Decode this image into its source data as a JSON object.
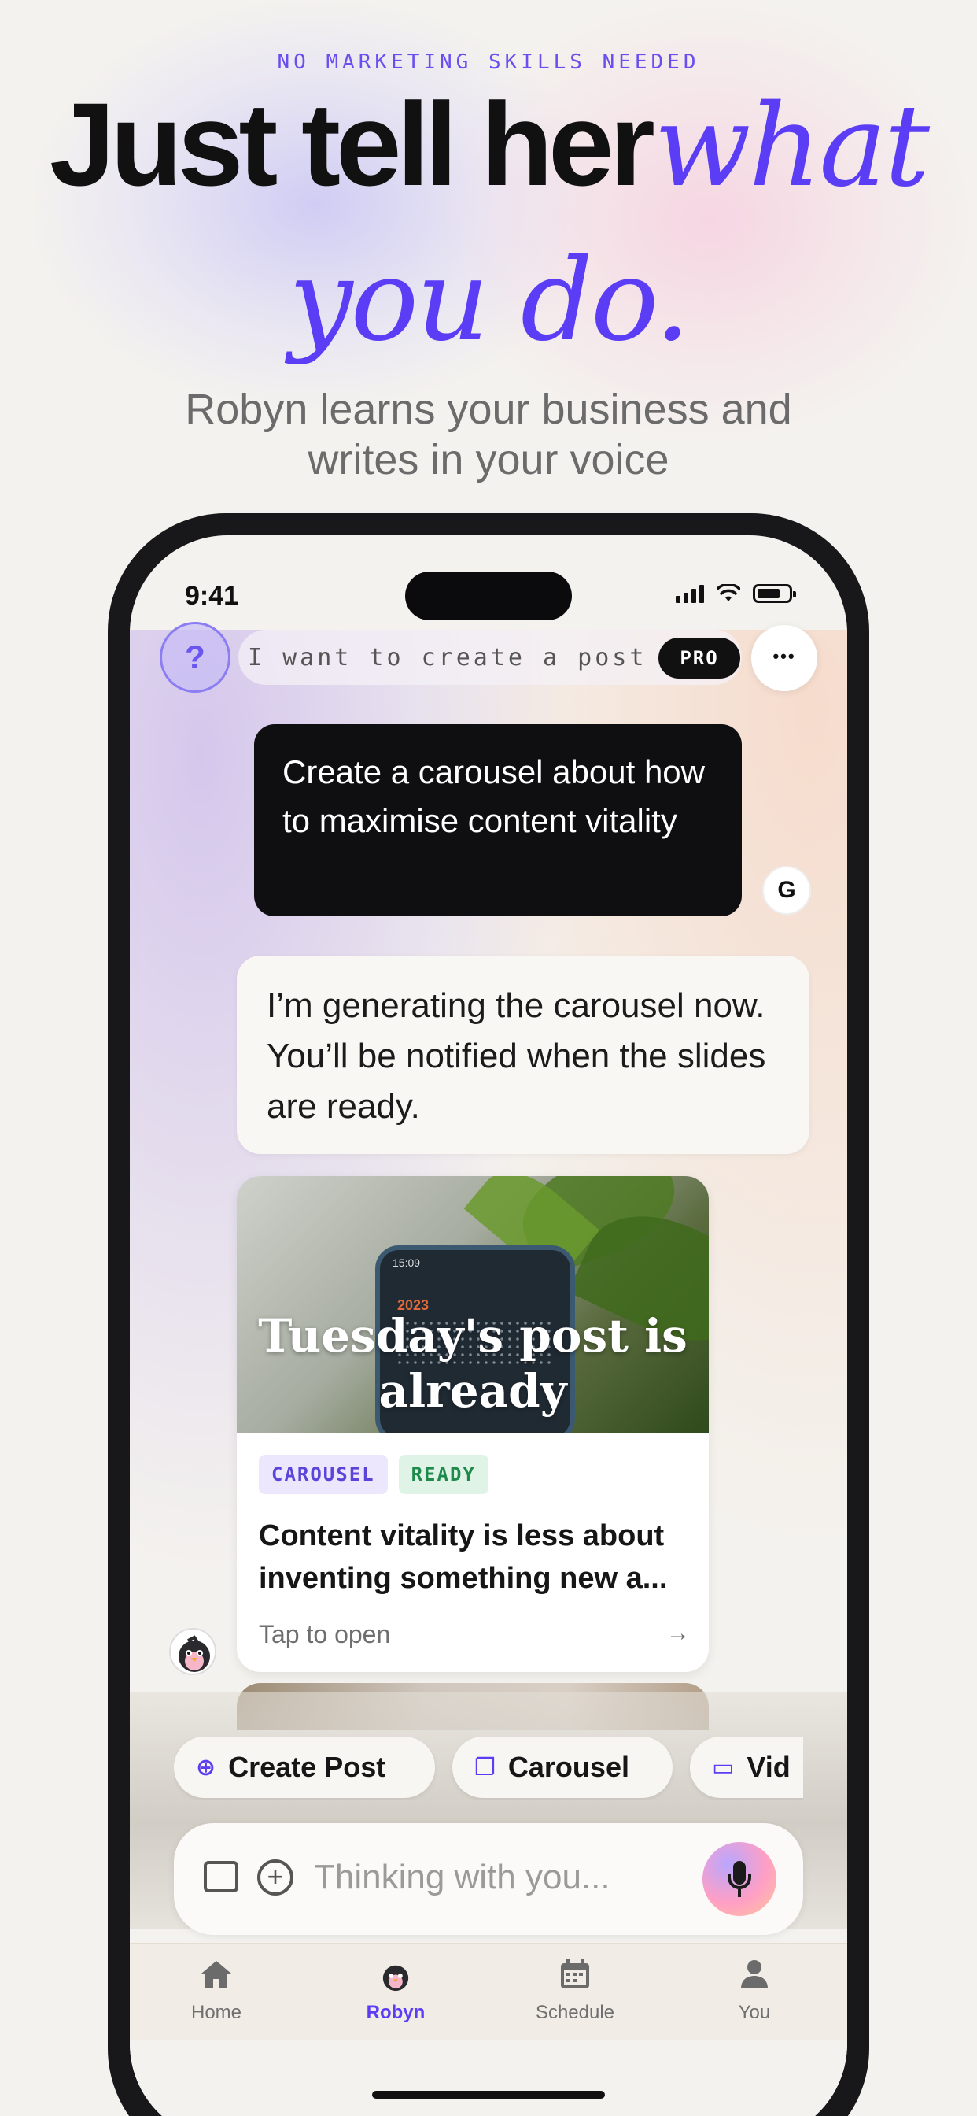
{
  "hero": {
    "eyebrow": "NO MARKETING SKILLS NEEDED",
    "headline_bold": "Just tell her",
    "headline_italic_1": "what",
    "headline_italic_2": "you do.",
    "subhead_line1": "Robyn learns your business and",
    "subhead_line2": "writes in your voice"
  },
  "status_bar": {
    "time": "9:41"
  },
  "top_bar": {
    "help_label": "?",
    "prompt_text": "I want to create a post …",
    "pro_badge": "PRO",
    "more_label": "•••"
  },
  "chat": {
    "user_message": "Create a carousel about how to maximise content vitality",
    "user_avatar_initial": "G",
    "bot_message": "I’m generating the carousel now. You’ll be notified when the slides are ready."
  },
  "carousel_card": {
    "image_title": "Tuesday's post is already",
    "image_phone_time": "15:09",
    "image_year": "2023",
    "badges": [
      "CAROUSEL",
      "READY"
    ],
    "excerpt": "Content vitality is less about inventing something new a...",
    "footer": "Tap to open",
    "footer_arrow": "→"
  },
  "quick_actions": [
    {
      "label": "Create Post",
      "icon": "plus-circle-icon"
    },
    {
      "label": "Carousel",
      "icon": "carousel-icon"
    },
    {
      "label": "Vid",
      "icon": "video-icon"
    }
  ],
  "composer": {
    "placeholder": "Thinking with you..."
  },
  "tab_bar": {
    "items": [
      {
        "label": "Home",
        "icon": "home-icon"
      },
      {
        "label": "Robyn",
        "icon": "robyn-avatar-icon",
        "active": true
      },
      {
        "label": "Schedule",
        "icon": "calendar-icon"
      },
      {
        "label": "You",
        "icon": "person-icon"
      }
    ]
  },
  "colors": {
    "accent": "#5b3df5",
    "ready": "#1f8a4c",
    "background": "#f4f2ee"
  }
}
